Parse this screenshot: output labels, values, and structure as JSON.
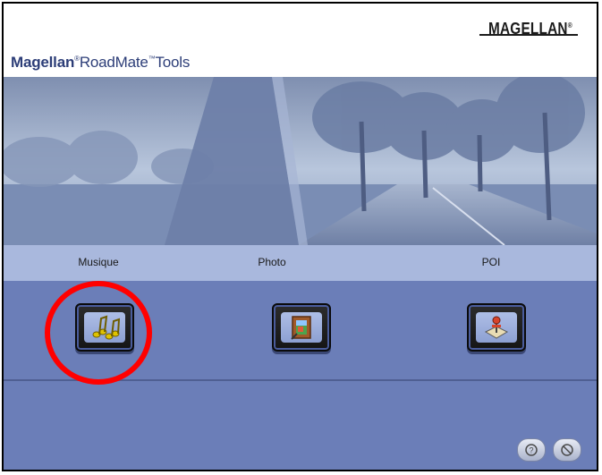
{
  "header": {
    "app_title_brand": "Magellan",
    "app_title_reg": "®",
    "app_title_product": "RoadMate",
    "app_title_tm": "™",
    "app_title_suffix": "Tools",
    "logo_text": "MAGELLAN",
    "logo_reg": "®"
  },
  "tools": [
    {
      "label": "Musique",
      "icon": "music-notes-icon"
    },
    {
      "label": "Photo",
      "icon": "photo-frame-icon"
    },
    {
      "label": "POI",
      "icon": "map-pin-icon"
    }
  ],
  "footer": {
    "help_icon": "help-icon",
    "close_icon": "cancel-icon"
  },
  "colors": {
    "title": "#2d3e78",
    "labels_bar": "#a9b8dd",
    "panel": "#6b7eb8",
    "highlight_ring": "#ff0000",
    "music_notes": "#e0c300"
  }
}
